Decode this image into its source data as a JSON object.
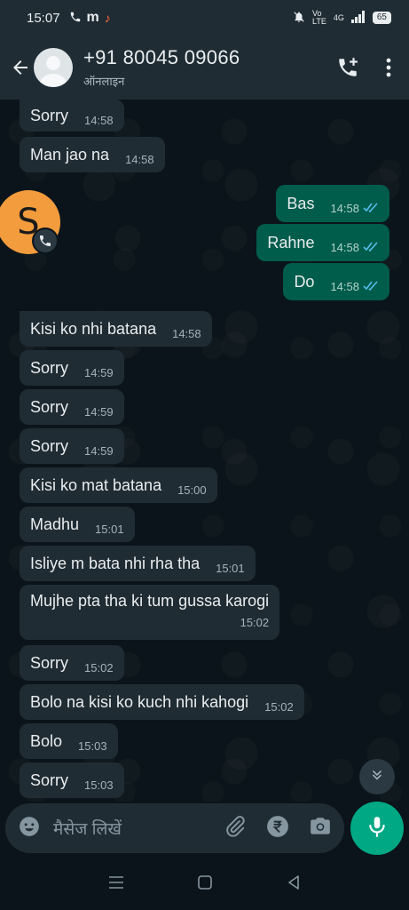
{
  "status_bar": {
    "time": "15:07",
    "battery": "65",
    "network": "4G"
  },
  "header": {
    "contact_name": "+91 80045 09066",
    "contact_status": "ऑनलाइन"
  },
  "messages": [
    {
      "dir": "in",
      "text": "Sorry",
      "time": "14:58"
    },
    {
      "dir": "in",
      "text": "Man jao na",
      "time": "14:58"
    },
    {
      "dir": "out",
      "text": "Bas",
      "time": "14:58"
    },
    {
      "dir": "out",
      "text": "Rahne",
      "time": "14:58"
    },
    {
      "dir": "out",
      "text": "Do",
      "time": "14:58"
    },
    {
      "dir": "in",
      "text": "Kisi ko nhi batana",
      "time": "14:58"
    },
    {
      "dir": "in",
      "text": "Sorry",
      "time": "14:59"
    },
    {
      "dir": "in",
      "text": "Sorry",
      "time": "14:59"
    },
    {
      "dir": "in",
      "text": "Sorry",
      "time": "14:59"
    },
    {
      "dir": "in",
      "text": "Kisi ko mat batana",
      "time": "15:00"
    },
    {
      "dir": "in",
      "text": "Madhu",
      "time": "15:01"
    },
    {
      "dir": "in",
      "text": "Isliye m bata nhi rha tha",
      "time": "15:01"
    },
    {
      "dir": "in",
      "text": "Mujhe pta tha ki tum gussa karogi",
      "time": "15:02"
    },
    {
      "dir": "in",
      "text": "Sorry",
      "time": "15:02"
    },
    {
      "dir": "in",
      "text": "Bolo na kisi ko kuch nhi kahogi",
      "time": "15:02"
    },
    {
      "dir": "in",
      "text": "Bolo",
      "time": "15:03"
    },
    {
      "dir": "in",
      "text": "Sorry",
      "time": "15:03"
    }
  ],
  "floating_avatar": {
    "letter": "S",
    "color": "#f29c3d"
  },
  "input": {
    "placeholder": "मैसेज लिखें"
  },
  "colors": {
    "incoming_bubble": "#202c33",
    "outgoing_bubble": "#005c4b",
    "accent": "#00a884",
    "read_ticks": "#53bdeb"
  }
}
